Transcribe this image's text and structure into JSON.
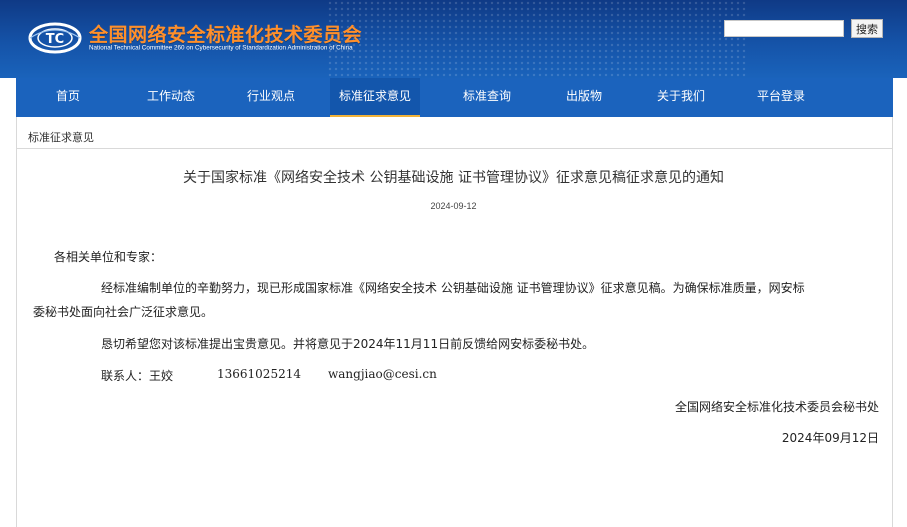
{
  "header": {
    "site_title": "全国网络安全标准化技术委员会",
    "site_subtitle": "National Technical Committee 260 on Cybersecurity of Standardization Administration of China",
    "logo_text": "TC",
    "search_placeholder": "",
    "search_button": "搜索"
  },
  "nav": {
    "items": [
      {
        "label": "首页"
      },
      {
        "label": "工作动态"
      },
      {
        "label": "行业观点"
      },
      {
        "label": "标准征求意见",
        "active": true
      },
      {
        "label": "标准查询"
      },
      {
        "label": "出版物"
      },
      {
        "label": "关于我们"
      },
      {
        "label": "平台登录"
      }
    ]
  },
  "breadcrumb": "标准征求意见",
  "article": {
    "title": "关于国家标准《网络安全技术 公钥基础设施 证书管理协议》征求意见稿征求意见的通知",
    "date": "2024-09-12",
    "greeting": "各相关单位和专家：",
    "para1_line1": "经标准编制单位的辛勤努力，现已形成国家标准《网络安全技术 公钥基础设施 证书管理协议》征求意见稿。为确保标准质量，网安标",
    "para1_line2": "委秘书处面向社会广泛征求意见。",
    "para2": "恳切希望您对该标准提出宝贵意见。并将意见于2024年11月11日前反馈给网安标委秘书处。",
    "contact_label": "联系人：王姣",
    "contact_phone": "13661025214",
    "contact_email": "wangjiao@cesi.cn",
    "signature": "全国网络安全标准化技术委员会秘书处",
    "sign_date": "2024年09月12日"
  },
  "colors": {
    "nav_bg": "#1b63bd",
    "header_bg": "#1553a8",
    "title_orange": "#ff8f2a",
    "active_underline": "#f0b239"
  }
}
